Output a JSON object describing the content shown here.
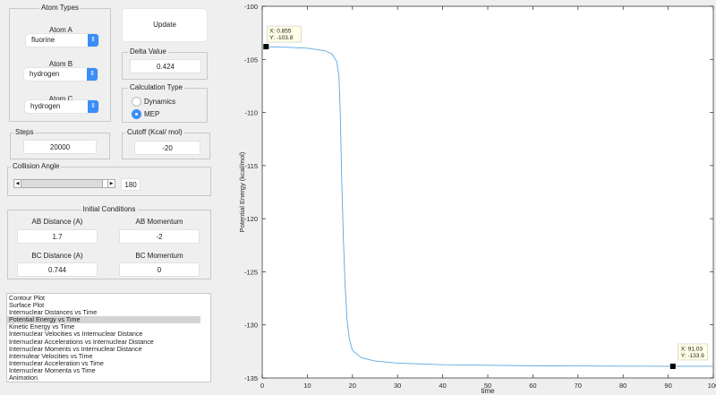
{
  "atom_types": {
    "title": "Atom Types",
    "atom_a": {
      "label": "Atom A",
      "value": "fluorine"
    },
    "atom_b": {
      "label": "Atom B",
      "value": "hydrogen"
    },
    "atom_c": {
      "label": "Atom C",
      "value": "hydrogen"
    }
  },
  "update_label": "Update",
  "delta": {
    "title": "Delta Value",
    "value": "0.424"
  },
  "calc_type": {
    "title": "Calculation Type",
    "options": [
      "Dynamics",
      "MEP"
    ],
    "selected": "MEP"
  },
  "steps": {
    "title": "Steps",
    "value": "20000"
  },
  "cutoff": {
    "title": "Cutoff (Kcal/ mol)",
    "value": "-20"
  },
  "collision": {
    "title": "Collision Angle",
    "value": "180",
    "slider_fraction": 1.0
  },
  "initial": {
    "title": "Initial Conditions",
    "ab_distance_label": "AB Distance (A)",
    "ab_distance": "1.7",
    "ab_momentum_label": "AB Momentum",
    "ab_momentum": "-2",
    "bc_distance_label": "BC Distance (A)",
    "bc_distance": "0.744",
    "bc_momentum_label": "BC Momentum",
    "bc_momentum": "0"
  },
  "plot_list": {
    "items": [
      "Contour Plot",
      "Surface Plot",
      "Internuclear Distances vs Time",
      "Potential Energy vs Time",
      "Kinetic Energy vs Time",
      "Internuclear Velocities vs Internuclear Distance",
      "Internuclear Accelerations vs Internuclear Distance",
      "Internuclear Moments vs Internuclear Distance",
      "Internulear Velocities vs Time",
      "Internuclear Acceleration vs Time",
      "Internuclear Momenta vs Time",
      "Animation"
    ],
    "selected_index": 3
  },
  "chart_data": {
    "type": "line",
    "xlabel": "time",
    "ylabel": "Potential Energy (kcal/mol)",
    "xlim": [
      0,
      100
    ],
    "ylim": [
      -135,
      -100
    ],
    "xticks": [
      "0",
      "10",
      "20",
      "30",
      "40",
      "50",
      "60",
      "70",
      "80",
      "90",
      "100"
    ],
    "yticks": [
      "-100",
      "-105",
      "-110",
      "-115",
      "-120",
      "-125",
      "-130",
      "-135"
    ],
    "series": [
      {
        "name": "PE",
        "color": "#5aa7e0",
        "x": [
          0,
          0.855,
          5,
          10,
          14,
          15.5,
          16.5,
          17,
          17.3,
          17.6,
          18,
          18.4,
          18.8,
          19.3,
          20,
          22,
          25,
          30,
          40,
          50,
          60,
          70,
          80,
          91.03,
          100
        ],
        "y": [
          -103.8,
          -103.8,
          -103.85,
          -103.95,
          -104.2,
          -104.5,
          -105.2,
          -106.5,
          -110,
          -116,
          -122,
          -126.5,
          -129.5,
          -131.3,
          -132.4,
          -133.1,
          -133.4,
          -133.6,
          -133.75,
          -133.8,
          -133.85,
          -133.87,
          -133.89,
          -133.9,
          -133.9
        ]
      }
    ],
    "datatips": [
      {
        "x_text": "X: 0.855",
        "y_text": "Y: -103.8",
        "x": 0.855,
        "y": -103.8
      },
      {
        "x_text": "X: 91.03",
        "y_text": "Y: -133.9",
        "x": 91.03,
        "y": -133.9
      }
    ]
  }
}
